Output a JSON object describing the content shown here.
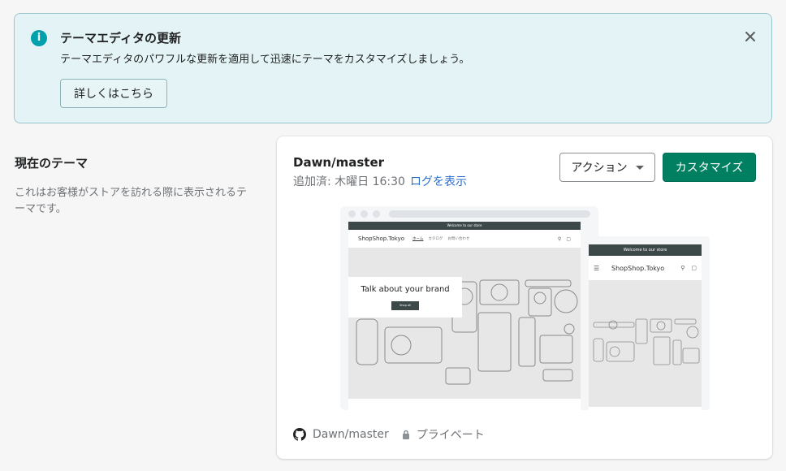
{
  "banner": {
    "title": "テーマエディタの更新",
    "description": "テーマエディタのパワフルな更新を適用して迅速にテーマをカスタマイズしましょう。",
    "learn_more": "詳しくはこちら"
  },
  "current_theme": {
    "title": "現在のテーマ",
    "description": "これはお客様がストアを訪れる際に表示されるテーマです。"
  },
  "card": {
    "theme_name": "Dawn/master",
    "added_label": "追加済: 木曜日 16:30",
    "view_log": "ログを表示",
    "actions_button": "アクション",
    "customize_button": "カスタマイズ",
    "repo_name": "Dawn/master",
    "visibility": "プライベート"
  },
  "preview": {
    "desktop": {
      "announcement": "Welcome to our store",
      "logo": "ShopShop.Tokyo",
      "nav_links": [
        "ホーム",
        "カタログ",
        "お問い合わせ"
      ],
      "hero_title": "Talk about your brand",
      "hero_button": "Shop all"
    },
    "mobile": {
      "announcement": "Welcome to our store",
      "logo": "ShopShop.Tokyo"
    }
  },
  "colors": {
    "accent": "#008060",
    "link": "#2c6ecb",
    "banner_bg": "#e4f4f6",
    "info_icon": "#00a0ac"
  }
}
